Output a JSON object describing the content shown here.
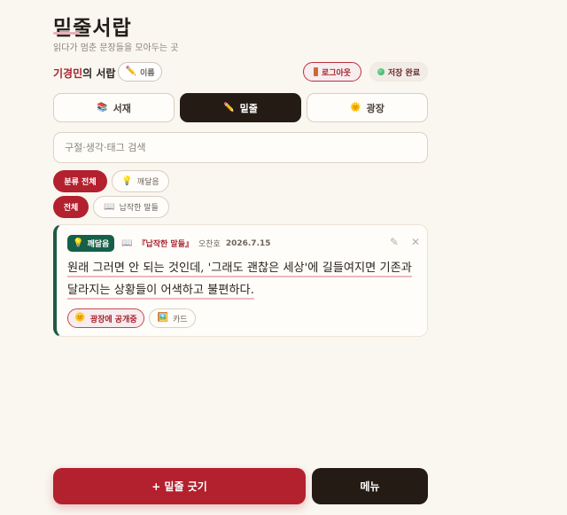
{
  "header": {
    "title": "밑줄서랍",
    "subtitle": "읽다가 멈춘 문장들을 모아두는 곳"
  },
  "owner": {
    "name_highlight": "기경민",
    "name_suffix": "의 서랍",
    "edit_label": "이름",
    "logout_label": "로그아웃",
    "save_status": "저장 완료"
  },
  "tabs": [
    {
      "label": "서재",
      "icon": "books-icon",
      "active": false
    },
    {
      "label": "밑줄",
      "icon": "pencil-icon",
      "active": true
    },
    {
      "label": "광장",
      "icon": "sun-icon",
      "active": false
    }
  ],
  "search": {
    "placeholder": "구절·생각·태그 검색"
  },
  "filters": {
    "category": [
      {
        "label": "분류 전체",
        "active": true
      },
      {
        "label": "깨달음",
        "icon": "lightbulb-icon",
        "active": false
      }
    ],
    "book": [
      {
        "label": "전체",
        "active": true
      },
      {
        "label": "납작한 말들",
        "icon": "book-icon",
        "active": false
      }
    ]
  },
  "card": {
    "category_badge": "깨달음",
    "book_title": "『납작한 말들』",
    "author": "오찬호",
    "date": "2026.7.15",
    "quote_line1": "원래 그러면 안 되는 것인데, '그래도 괜찮은 세상'에 길들여지면 기존과",
    "quote_line2": "달라지는 상황들이 어색하고 불편하다.",
    "plaza_label": "광장에 공개중",
    "card_label": "카드"
  },
  "bottom": {
    "add_label": "+ 밑줄 긋기",
    "menu_label": "메뉴"
  },
  "colors": {
    "accent_red": "#b3202e",
    "dark": "#231b14",
    "green": "#166049",
    "background": "#faf6f0"
  }
}
